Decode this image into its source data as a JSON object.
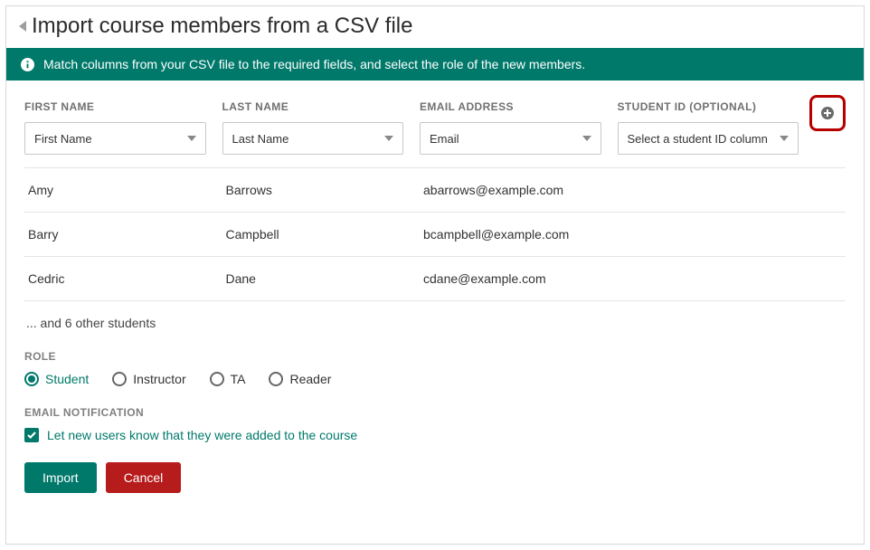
{
  "header": {
    "title": "Import course members from a CSV file"
  },
  "banner": {
    "text": "Match columns from your CSV file to the required fields, and select the role of the new members."
  },
  "columns": {
    "first_name": {
      "label": "FIRST NAME",
      "value": "First Name"
    },
    "last_name": {
      "label": "LAST NAME",
      "value": "Last Name"
    },
    "email": {
      "label": "EMAIL ADDRESS",
      "value": "Email"
    },
    "student_id": {
      "label": "STUDENT ID (OPTIONAL)",
      "value": "Select a student ID column"
    }
  },
  "rows": [
    {
      "first": "Amy",
      "last": "Barrows",
      "email": "abarrows@example.com",
      "id": ""
    },
    {
      "first": "Barry",
      "last": "Campbell",
      "email": "bcampbell@example.com",
      "id": ""
    },
    {
      "first": "Cedric",
      "last": "Dane",
      "email": "cdane@example.com",
      "id": ""
    }
  ],
  "more": "... and 6 other students",
  "role": {
    "label": "ROLE",
    "options": {
      "student": "Student",
      "instructor": "Instructor",
      "ta": "TA",
      "reader": "Reader"
    },
    "selected": "student"
  },
  "notification": {
    "label": "EMAIL NOTIFICATION",
    "checkbox_label": "Let new users know that they were added to the course",
    "checked": true
  },
  "buttons": {
    "import": "Import",
    "cancel": "Cancel"
  }
}
